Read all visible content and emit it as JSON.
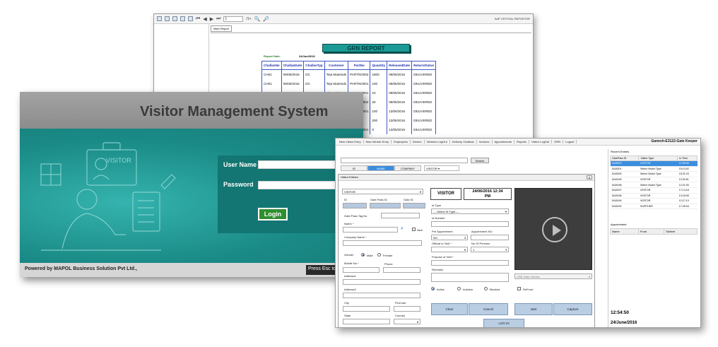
{
  "report": {
    "brand": "SAP CRYSTAL REPORTS®",
    "page_number": "1",
    "page_total": "/1+",
    "tab": "Main Report",
    "title": "GRN REPORT",
    "date_label": "Report Date:",
    "date_value": "24/Jun/2016",
    "columns": [
      "ChallanNo",
      "ChallanDate",
      "ChallanTyp",
      "Customer",
      "PartNo",
      "Quantity",
      "ReleasedDate",
      "ReturnStatus"
    ],
    "rows": [
      [
        "CH01",
        "09/06/2016",
        "DC",
        "Teja Materials",
        "PARTNO002",
        "1800",
        "09/06/2016",
        "DELIVERED"
      ],
      [
        "CH01",
        "09/06/2016",
        "DC",
        "Teja Materials",
        "PARTNO001",
        "100",
        "09/06/2016",
        "DELIVERED"
      ],
      [
        "",
        "",
        "",
        "ek Logistics",
        "PARTNO001",
        "10",
        "09/06/2016",
        "DELIVERED"
      ],
      [
        "",
        "",
        "",
        "ek Logistics",
        "PARTNO002",
        "20",
        "09/06/2016",
        "DELIVERED"
      ],
      [
        "",
        "",
        "",
        "ankumar",
        "PARTNO001",
        "100",
        "13/06/2016",
        "DELIVERED"
      ],
      [
        "",
        "",
        "",
        "ankumar",
        "23423",
        "200",
        "13/06/2016",
        "DELIVERED"
      ],
      [
        "",
        "",
        "",
        "ankumar",
        "PARTNO001",
        "0",
        "13/06/2016",
        "DELIVERED"
      ]
    ]
  },
  "login": {
    "title": "Visitor Management System",
    "visitor_badge": "VISITOR",
    "user_label": "User Name",
    "password_label": "Password",
    "button": "Login",
    "powered_by": "Powered by MAPOL Business Solution Pvt Ltd.,",
    "esc_hint": "Press Esc to"
  },
  "main": {
    "menu": [
      "New Visitor Entry",
      "New Vehicle Entry",
      "Employees",
      "Drivers",
      "Vehicles LogOut",
      "Delivery Challans",
      "Invoices",
      "Appointments",
      "Reports",
      "Visitor LogOut",
      "GRN",
      "Logout"
    ],
    "gate_keeper": "Ganesh-E3122-Gate Keeper",
    "search_button": "Search",
    "search_tabs": [
      "ID",
      "NAME",
      "COMPANY"
    ],
    "search_combo": "VISITOR",
    "entry": {
      "title": "Visitor Entries",
      "close": "X",
      "type_combo": "VISITOR",
      "id_label": "ID",
      "gate_pass_id_label": "Gate Pass ID",
      "gate_id_label": "Gate ID",
      "gate_pass_tag_label": "Gate Pass Tag No",
      "name_label": "Name",
      "new_label": "New",
      "company_label": "Company Name",
      "gender_label": "Gender",
      "male": "Male",
      "female": "Female",
      "mobile_label": "Mobile No",
      "phone_label": "Phone",
      "address1_label": "Address1",
      "address2_label": "Address2",
      "city_label": "City",
      "pincode_label": "PinCode",
      "state_label": "State",
      "country_label": "Country",
      "badge": "VISITOR",
      "badge_date": "24/06/2016 12:34 PM",
      "id_type_label": "Id Type",
      "id_type_value": "----Select ID Type----",
      "id_number_label": "Id Number",
      "pre_appointment_label": "Pre Appointment",
      "pre_appointment_value": "NO",
      "appointment_no_label": "Appointment NO",
      "official_label": "Official to Visit",
      "persons_label": "No Of Persons",
      "persons_value": "1",
      "purpose_label": "Purpose of Visit",
      "remarks_label": "Remarks",
      "video_device": "USB Video Device",
      "status_active": "Active",
      "status_inactive": "InActive",
      "status_blocked": "Blocked",
      "refront": "ReFront",
      "clear": "Clear",
      "cancel": "Cancel",
      "start": "start",
      "capture": "Capture",
      "login": "LOG IN"
    },
    "recent": {
      "title": "Recent Entries",
      "columns": [
        "GatePass ID",
        "Visitor Type",
        "In Time"
      ],
      "rows": [
        [
          "1618203",
          "VISITOR",
          "12:09:06"
        ],
        [
          "1618201",
          "Select Visitor Type",
          "15:13:02"
        ],
        [
          "1618200",
          "Select Visitor Type",
          "15:31:23"
        ],
        [
          "1618199",
          "VISITOR",
          "13:30:51"
        ],
        [
          "1618198",
          "Select Visitor Type",
          "12:21:00"
        ],
        [
          "1618197",
          "VISITOR",
          "17:14:18"
        ],
        [
          "1618196",
          "VISITOR",
          "13:18:05"
        ],
        [
          "1618194",
          "VISITOR",
          "12:17:13"
        ],
        [
          "1618192",
          "SUPPLIER",
          "17:25:04"
        ]
      ]
    },
    "appointment": {
      "title": "Appointment",
      "columns": [
        "Name",
        "From",
        "ToMeet"
      ]
    },
    "clock": "12:54:50",
    "clock_date": "24/June/2016"
  }
}
